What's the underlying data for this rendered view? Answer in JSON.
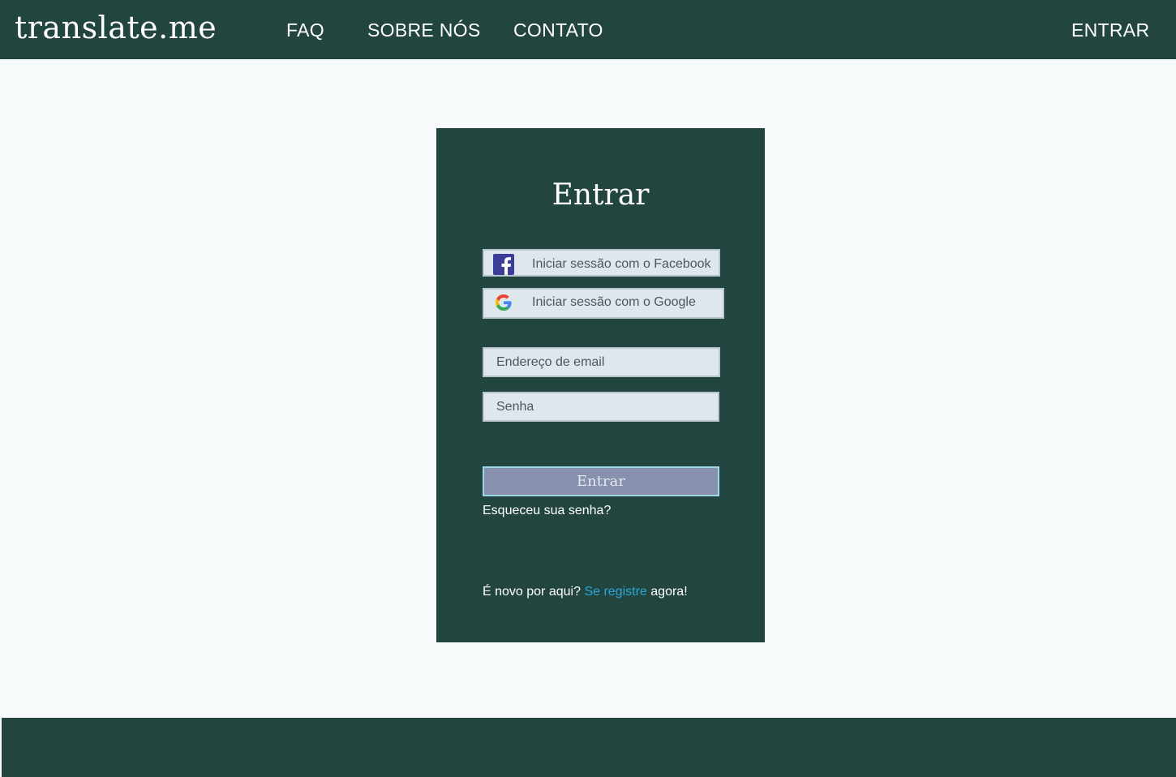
{
  "header": {
    "logo": "translate.me",
    "nav": [
      "FAQ",
      "SOBRE NÓS",
      "CONTATO"
    ],
    "login": "ENTRAR"
  },
  "card": {
    "title": "Entrar",
    "facebook_label": "Iniciar sessão com o Facebook",
    "google_label": "Iniciar sessão com o Google",
    "email_placeholder": "Endereço de email",
    "password_placeholder": "Senha",
    "submit_label": "Entrar",
    "forgot_label": "Esqueceu sua senha?",
    "register_prefix": "É novo por aqui?",
    "register_link": "Se registre",
    "register_suffix": "agora!"
  },
  "icons": {
    "facebook": "facebook-icon",
    "google": "google-icon"
  },
  "colors": {
    "primary": "#234540",
    "background": "#f6fafb",
    "button": "#8790ad",
    "link": "#2aa6d6",
    "facebook": "#3c3d99"
  }
}
